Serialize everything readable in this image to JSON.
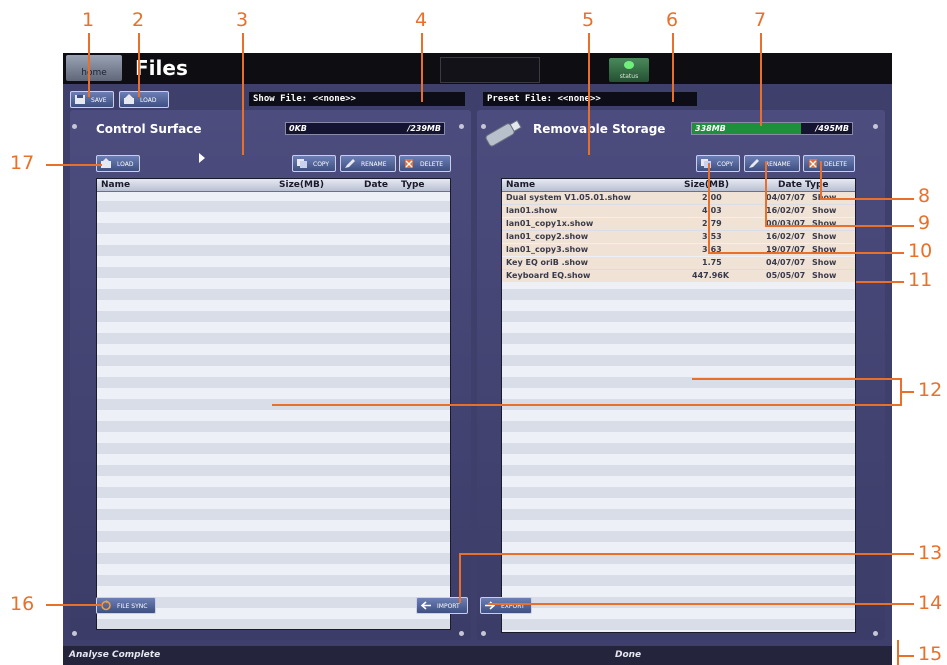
{
  "topbar": {
    "home_label": "home",
    "title": "Files",
    "status_label": "status"
  },
  "actions": {
    "save_label": "SAVE",
    "load_label": "LOAD"
  },
  "show_file": "Show File: <<none>>",
  "preset_file": "Preset File: <<none>>",
  "control_surface": {
    "title": "Control Surface",
    "meter": {
      "used": "0KB",
      "total": "/239MB",
      "used_fraction": 0.0
    },
    "load_label": "LOAD",
    "copy_label": "COPY",
    "rename_label": "RENAME",
    "delete_label": "DELETE",
    "columns": {
      "name": "Name",
      "size": "Size(MB)",
      "date": "Date",
      "type": "Type"
    },
    "file_sync_label": "FILE SYNC",
    "import_label": "IMPORT"
  },
  "removable_storage": {
    "title": "Removable Storage",
    "meter": {
      "used": "338MB",
      "total": "/495MB",
      "used_fraction": 0.68
    },
    "copy_label": "COPY",
    "rename_label": "RENAME",
    "delete_label": "DELETE",
    "columns": {
      "name": "Name",
      "size": "Size(MB)",
      "date": "Date",
      "type": "Type"
    },
    "files": [
      {
        "name": "Dual system V1.05.01.show",
        "size": "2.00",
        "date": "04/07/07",
        "type": "Show"
      },
      {
        "name": "lan01.show",
        "size": "4.03",
        "date": "16/02/07",
        "type": "Show"
      },
      {
        "name": "lan01_copy1x.show",
        "size": "2.79",
        "date": "00/03/07",
        "type": "Show"
      },
      {
        "name": "lan01_copy2.show",
        "size": "3.53",
        "date": "16/02/07",
        "type": "Show"
      },
      {
        "name": "lan01_copy3.show",
        "size": "3.63",
        "date": "19/07/07",
        "type": "Show"
      },
      {
        "name": "Key EQ oriB .show",
        "size": "1.75",
        "date": "04/07/07",
        "type": "Show"
      },
      {
        "name": "Keyboard EQ.show",
        "size": "447.96K",
        "date": "05/05/07",
        "type": "Show"
      }
    ],
    "export_label": "EXPORT"
  },
  "statusbar": {
    "left": "Analyse Complete",
    "center": "Done"
  },
  "callouts": {
    "n1": "1",
    "n2": "2",
    "n3": "3",
    "n4": "4",
    "n5": "5",
    "n6": "6",
    "n7": "7",
    "n8": "8",
    "n9": "9",
    "n10": "10",
    "n11": "11",
    "n12": "12",
    "n13": "13",
    "n14": "14",
    "n15": "15",
    "n16": "16",
    "n17": "17"
  },
  "colors": {
    "callout": "#e8702a",
    "panel": "#4c4c7e",
    "meter_fill": "#1e8f3a"
  }
}
